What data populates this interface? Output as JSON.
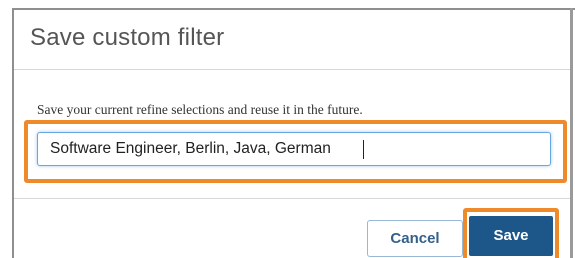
{
  "dialog": {
    "title": "Save custom filter",
    "description": "Save your current refine selections and reuse it in the future.",
    "input_value": "Software Engineer, Berlin, Java, German",
    "cancel_label": "Cancel",
    "save_label": "Save"
  },
  "colors": {
    "highlight": "#ef8a2a",
    "primary_button": "#1d5688",
    "secondary_text": "#35608a",
    "focus_border": "#6aa7dc"
  }
}
